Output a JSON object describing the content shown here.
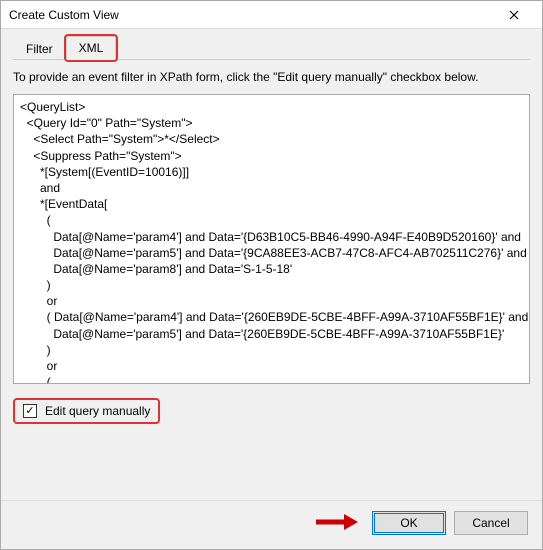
{
  "titlebar": {
    "title": "Create Custom View"
  },
  "tabs": {
    "filter": "Filter",
    "xml": "XML"
  },
  "instruction": "To provide an event filter in XPath form, click the \"Edit query manually\" checkbox below.",
  "query_lines": [
    "<QueryList>",
    "  <Query Id=\"0\" Path=\"System\">",
    "    <Select Path=\"System\">*</Select>",
    "    <Suppress Path=\"System\">",
    "      *[System[(EventID=10016)]]",
    "      and",
    "      *[EventData[",
    "        (",
    "          Data[@Name='param4'] and Data='{D63B10C5-BB46-4990-A94F-E40B9D520160}' and",
    "          Data[@Name='param5'] and Data='{9CA88EE3-ACB7-47C8-AFC4-AB702511C276}' and",
    "          Data[@Name='param8'] and Data='S-1-5-18'",
    "        )",
    "        or",
    "        ( Data[@Name='param4'] and Data='{260EB9DE-5CBE-4BFF-A99A-3710AF55BF1E}' and",
    "          Data[@Name='param5'] and Data='{260EB9DE-5CBE-4BFF-A99A-3710AF55BF1E}'",
    "        )",
    "        or",
    "        ("
  ],
  "edit_manual": {
    "label": "Edit query manually",
    "checked": true
  },
  "buttons": {
    "ok": "OK",
    "cancel": "Cancel"
  }
}
